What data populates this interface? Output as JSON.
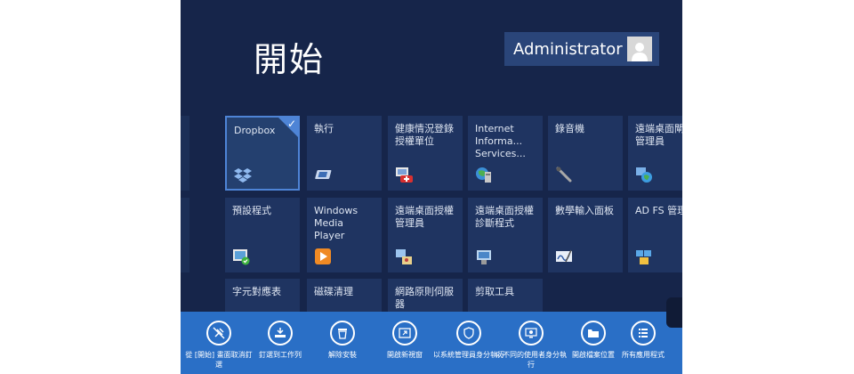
{
  "start_title": "開始",
  "user": {
    "name": "Administrator",
    "avatar_icon": "user-avatar-icon"
  },
  "tiles": {
    "dropbox": {
      "label": "Dropbox",
      "icon": "dropbox-icon",
      "selected": true
    },
    "run": {
      "label": "執行",
      "icon": "run-icon"
    },
    "health": {
      "label": "健康情況登錄授權單位",
      "icon": "health-registration-icon"
    },
    "iis": {
      "label": "Internet Informa... Services...",
      "icon": "iis-icon"
    },
    "recorder": {
      "label": "錄音機",
      "icon": "microphone-icon"
    },
    "rd_gateway": {
      "label": "遠端桌面閘道管理員",
      "icon": "rd-gateway-icon"
    },
    "default_programs": {
      "label": "預設程式",
      "icon": "default-programs-icon"
    },
    "wmp": {
      "label": "Windows Media Player",
      "icon": "media-player-icon"
    },
    "rd_licensing_mgr": {
      "label": "遠端桌面授權管理員",
      "icon": "rd-licensing-manager-icon"
    },
    "rd_licensing_diag": {
      "label": "遠端桌面授權診斷程式",
      "icon": "rd-licensing-diagnoser-icon"
    },
    "math_input": {
      "label": "數學輸入面板",
      "icon": "math-input-icon"
    },
    "adfs": {
      "label": "AD FS 管理",
      "icon": "adfs-icon"
    },
    "charmap": {
      "label": "字元對應表"
    },
    "disk_cleanup": {
      "label": "磁碟清理"
    },
    "nps": {
      "label": "網路原則伺服器"
    },
    "snipping": {
      "label": "剪取工具"
    }
  },
  "app_bar": {
    "unpin": {
      "label": "從 [開始] 畫面取消釘選",
      "icon": "unpin-icon"
    },
    "pin_taskbar": {
      "label": "釘選到工作列",
      "icon": "pin-taskbar-icon"
    },
    "uninstall": {
      "label": "解除安裝",
      "icon": "trash-icon"
    },
    "new_window": {
      "label": "開啟新視窗",
      "icon": "new-window-icon"
    },
    "run_admin": {
      "label": "以系統管理員身分執行",
      "icon": "shield-icon"
    },
    "run_other_user": {
      "label": "以不同的使用者身分執行",
      "icon": "user-switch-icon"
    },
    "open_location": {
      "label": "開啟檔案位置",
      "icon": "folder-icon"
    },
    "all_apps": {
      "label": "所有應用程式",
      "icon": "list-icon"
    }
  },
  "colors": {
    "background": "#16254a",
    "tile": "#1f3461",
    "selected_border": "#4e84d6",
    "app_bar": "#2a6fc6"
  }
}
